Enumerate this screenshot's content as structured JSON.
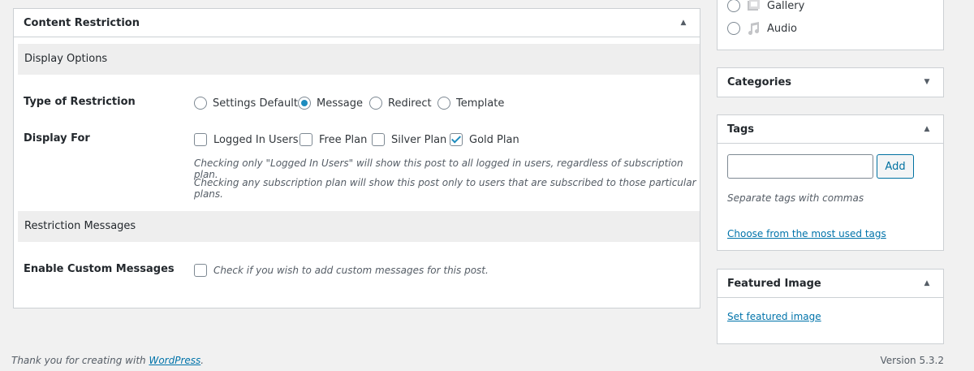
{
  "content_restriction": {
    "title": "Content Restriction",
    "display_options_heading": "Display Options",
    "type_label": "Type of Restriction",
    "type_options": [
      {
        "label": "Settings Default",
        "checked": false
      },
      {
        "label": "Message",
        "checked": true
      },
      {
        "label": "Redirect",
        "checked": false
      },
      {
        "label": "Template",
        "checked": false
      }
    ],
    "display_for_label": "Display For",
    "display_for_options": [
      {
        "label": "Logged In Users",
        "checked": false
      },
      {
        "label": "Free Plan",
        "checked": false
      },
      {
        "label": "Silver Plan",
        "checked": false
      },
      {
        "label": "Gold Plan",
        "checked": true
      }
    ],
    "desc_line1": "Checking only \"Logged In Users\" will show this post to all logged in users, regardless of subscription plan.",
    "desc_line2": "Checking any subscription plan will show this post only to users that are subscribed to those particular plans.",
    "messages_heading": "Restriction Messages",
    "custom_messages_label": "Enable Custom Messages",
    "custom_messages_checkbox_label": "Check if you wish to add custom messages for this post."
  },
  "format_box": {
    "options": [
      {
        "label": "Gallery",
        "icon": "gallery-icon"
      },
      {
        "label": "Audio",
        "icon": "audio-icon"
      }
    ]
  },
  "categories": {
    "title": "Categories"
  },
  "tags": {
    "title": "Tags",
    "input_value": "",
    "add_label": "Add",
    "hint": "Separate tags with commas",
    "choose_link": "Choose from the most used tags"
  },
  "featured_image": {
    "title": "Featured Image",
    "set_link": "Set featured image"
  },
  "footer": {
    "thanks_prefix": "Thank you for creating with ",
    "wordpress_link": "WordPress",
    "thanks_suffix": ".",
    "version": "Version 5.3.2"
  }
}
